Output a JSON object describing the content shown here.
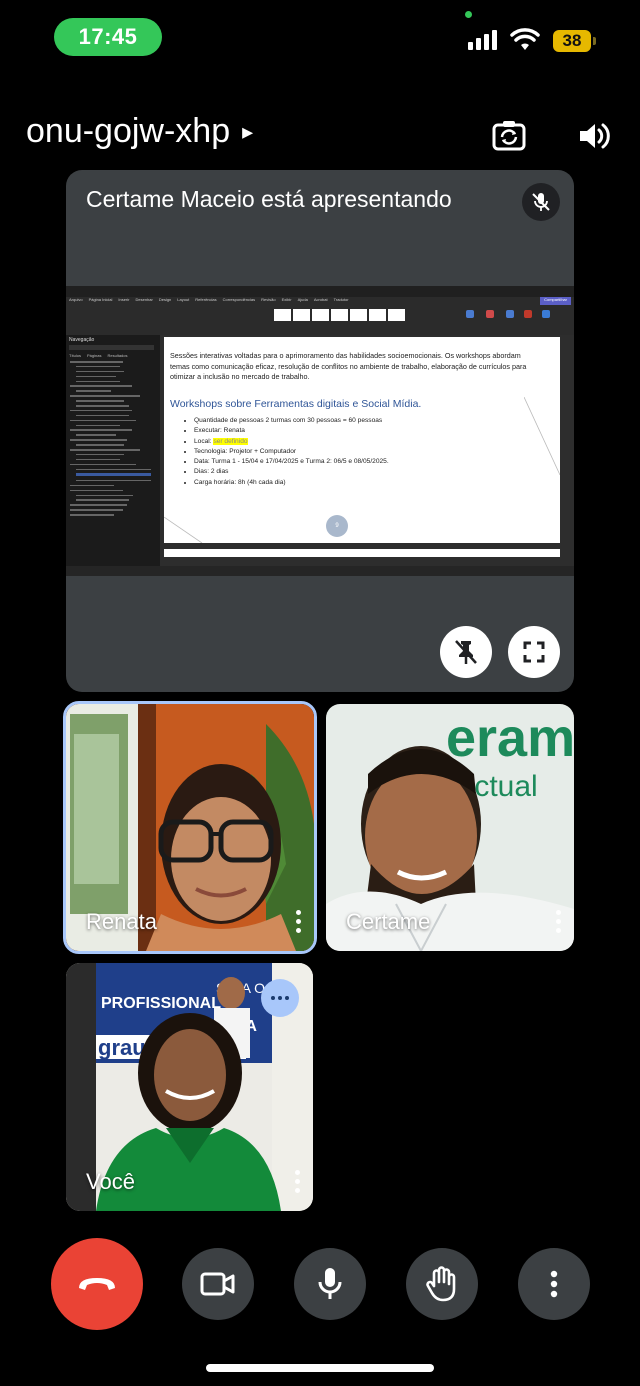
{
  "status_bar": {
    "time": "17:45",
    "battery": "38",
    "time_pill_color": "#34c759",
    "battery_color": "#e6b800"
  },
  "meeting": {
    "code": "onu-gojw-xhp",
    "chevron": "▸"
  },
  "presentation": {
    "title": "Certame Maceio está apresentando",
    "document": {
      "intro": "Sessões interativas voltadas para o aprimoramento das habilidades socioemocionais. Os workshops abordam temas como comunicação eficaz, resolução de conflitos no ambiente de trabalho, elaboração de currículos para otimizar a inclusão no mercado de trabalho.",
      "heading": "Workshops sobre Ferramentas digitais e Social Mídia.",
      "items": [
        {
          "label": "Quantidade de pessoas 2 turmas com 30 pessoas = 60 pessoas",
          "highlight": ""
        },
        {
          "label": "Executar: Renata",
          "highlight": ""
        },
        {
          "label": "Local: ",
          "highlight": "ser definido"
        },
        {
          "label": "Tecnologia: Projetor + Computador",
          "highlight": ""
        },
        {
          "label": "Data: Turma 1 - 15/04 e 17/04/2025 e Turma 2: 06/5 e 08/05/2025.",
          "highlight": ""
        },
        {
          "label": "Dias: 2 dias",
          "highlight": ""
        },
        {
          "label": "Carga horária: 8h (4h cada dia)",
          "highlight": ""
        }
      ],
      "page_number": "9"
    },
    "app": {
      "nav_title": "Navegação",
      "nav_tabs": [
        "Títulos",
        "Páginas",
        "Resultados"
      ],
      "menu": [
        "Arquivo",
        "Página Inicial",
        "Inserir",
        "Desenhar",
        "Design",
        "Layout",
        "Referências",
        "Correspondências",
        "Revisão",
        "Exibir",
        "Ajuda",
        "Acrobat",
        "Tradutor"
      ],
      "share_label": "Compartilhar"
    }
  },
  "participants": [
    {
      "name": "Renata",
      "active_speaker": true
    },
    {
      "name": "Certame",
      "active_speaker": false
    },
    {
      "name": "Você",
      "active_speaker": false
    }
  ],
  "controls": {
    "end_call_color": "#ea4335",
    "active_border_color": "#a8c7fa",
    "icons": [
      "end-call-icon",
      "camera-icon",
      "mic-icon",
      "raise-hand-icon",
      "more-vert-icon"
    ]
  }
}
